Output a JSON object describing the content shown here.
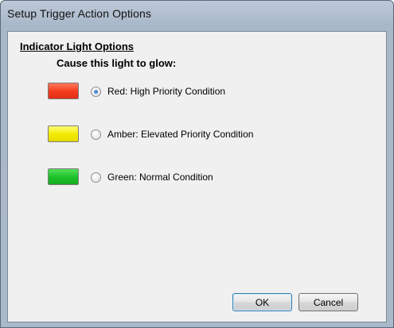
{
  "window": {
    "title": "Setup Trigger Action Options"
  },
  "group": {
    "title": "Indicator Light Options",
    "subheading": "Cause this light to glow:"
  },
  "options": [
    {
      "label": "Red: High Priority Condition",
      "color": "#f2391b",
      "selected": true
    },
    {
      "label": "Amber: Elevated Priority Condition",
      "color": "#f2ea00",
      "selected": false
    },
    {
      "label": "Green: Normal Condition",
      "color": "#1cc02a",
      "selected": false
    }
  ],
  "buttons": {
    "ok_label": "OK",
    "cancel_label": "Cancel"
  }
}
